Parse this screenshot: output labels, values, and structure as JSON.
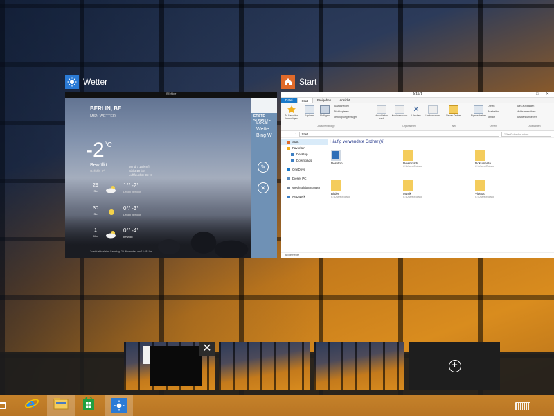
{
  "taskview": {
    "windows": [
      {
        "app": "Wetter",
        "icon": "sun-icon"
      },
      {
        "app": "Start",
        "icon": "home-icon"
      }
    ]
  },
  "weather": {
    "window_title": "Wetter",
    "city": "BERLIN, BE",
    "provider": "MSN WETTER",
    "temperature": "-2",
    "unit": "°C",
    "condition": "Bewölkt",
    "feels_like": "Gefühlt -7°",
    "details": [
      "Wind ↓ 16 km/h",
      "Sicht 10 km",
      "Luftfeuchte 93 %"
    ],
    "forecast": [
      {
        "day": "29",
        "sub": "Sa",
        "temp": "1°/ -2°",
        "desc": "Leicht bewölkt"
      },
      {
        "day": "30",
        "sub": "So",
        "temp": "0°/ -3°",
        "desc": "Leicht bewölkt"
      },
      {
        "day": "1",
        "sub": "Mo",
        "temp": "0°/ -4°",
        "desc": "bewölkt"
      }
    ],
    "footer": "Zuletzt aktualisiert Samstag, 29. November um 12:48 Uhr",
    "charm_header": "ERSTE SCHRITTE",
    "charm_text": "Lokal Wette Bing W"
  },
  "explorer": {
    "title": "Start",
    "tabs": [
      "Datei",
      "Start",
      "Freigeben",
      "Ansicht"
    ],
    "ribbon": {
      "fav": "Zu Favoriten hinzufügen",
      "copy": "Kopieren",
      "paste": "Einfügen",
      "cut": "Ausschneiden",
      "copy_path": "Pfad kopieren",
      "paste_link": "Verknüpfung einfügen",
      "move": "Verschieben nach",
      "copyto": "Kopieren nach",
      "delete": "Löschen",
      "rename": "Umbenennen",
      "new_folder": "Neuer Ordner",
      "properties": "Eigenschaften",
      "open": "Öffnen",
      "edit": "Bearbeiten",
      "history": "Verlauf",
      "select_all": "Alles auswählen",
      "select_none": "Nichts auswählen",
      "invert": "Auswahl umkehren",
      "g_clipboard": "Zwischenablage",
      "g_organize": "Organisieren",
      "g_new": "Neu",
      "g_open": "Öffnen",
      "g_select": "Auswählen"
    },
    "address": "Start",
    "search_placeholder": "\"Start\" durchsuchen",
    "nav": [
      {
        "label": "Start",
        "level": 0,
        "selected": true,
        "icon": "home-icon"
      },
      {
        "label": "Favoriten",
        "level": 0,
        "selected": false,
        "icon": "star-icon"
      },
      {
        "label": "Desktop",
        "level": 1,
        "selected": false,
        "icon": "desktop-icon"
      },
      {
        "label": "Downloads",
        "level": 1,
        "selected": false,
        "icon": "folder-icon"
      },
      {
        "label": "OneDrive",
        "level": 0,
        "selected": false,
        "icon": "cloud-icon"
      },
      {
        "label": "Dieser PC",
        "level": 0,
        "selected": false,
        "icon": "computer-icon"
      },
      {
        "label": "Wechseldatenträger",
        "level": 0,
        "selected": false,
        "icon": "drive-icon"
      },
      {
        "label": "Netzwerk",
        "level": 0,
        "selected": false,
        "icon": "network-icon"
      }
    ],
    "section_title": "Häufig verwendete Ordner (6)",
    "folders": [
      {
        "name": "Desktop",
        "path": ""
      },
      {
        "name": "Downloads",
        "path": "C:\\Users\\Roland"
      },
      {
        "name": "Dokumente",
        "path": "C:\\Users\\Roland"
      },
      {
        "name": "Bilder",
        "path": "C:\\Users\\Roland"
      },
      {
        "name": "Musik",
        "path": "C:\\Users\\Roland"
      },
      {
        "name": "Videos",
        "path": "C:\\Users\\Roland"
      }
    ],
    "status": "6 Elemente"
  },
  "desktops": {
    "close_glyph": "✕",
    "add_glyph": "+"
  },
  "taskbar": {
    "items": [
      "file-explorer-icon",
      "internet-explorer-icon",
      "explorer-folder-icon",
      "store-icon",
      "weather-icon"
    ],
    "keyboard": "touch-keyboard-icon"
  },
  "colors": {
    "accent": "#2b7bd6",
    "explorer_file_tab": "#1979ca",
    "taskbar": "#c6822a"
  }
}
